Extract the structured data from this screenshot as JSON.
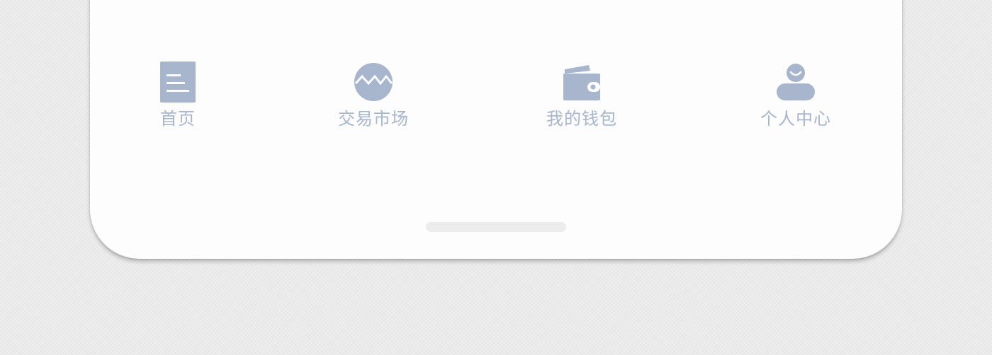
{
  "tabbar": {
    "items": [
      {
        "label": "首页",
        "icon": "document-icon"
      },
      {
        "label": "交易市场",
        "icon": "market-wave-icon"
      },
      {
        "label": "我的钱包",
        "icon": "wallet-icon"
      },
      {
        "label": "个人中心",
        "icon": "user-icon"
      }
    ]
  },
  "colors": {
    "icon": "#a7b6cd",
    "label": "#a7b6cd",
    "background": "#fdfdfd"
  }
}
